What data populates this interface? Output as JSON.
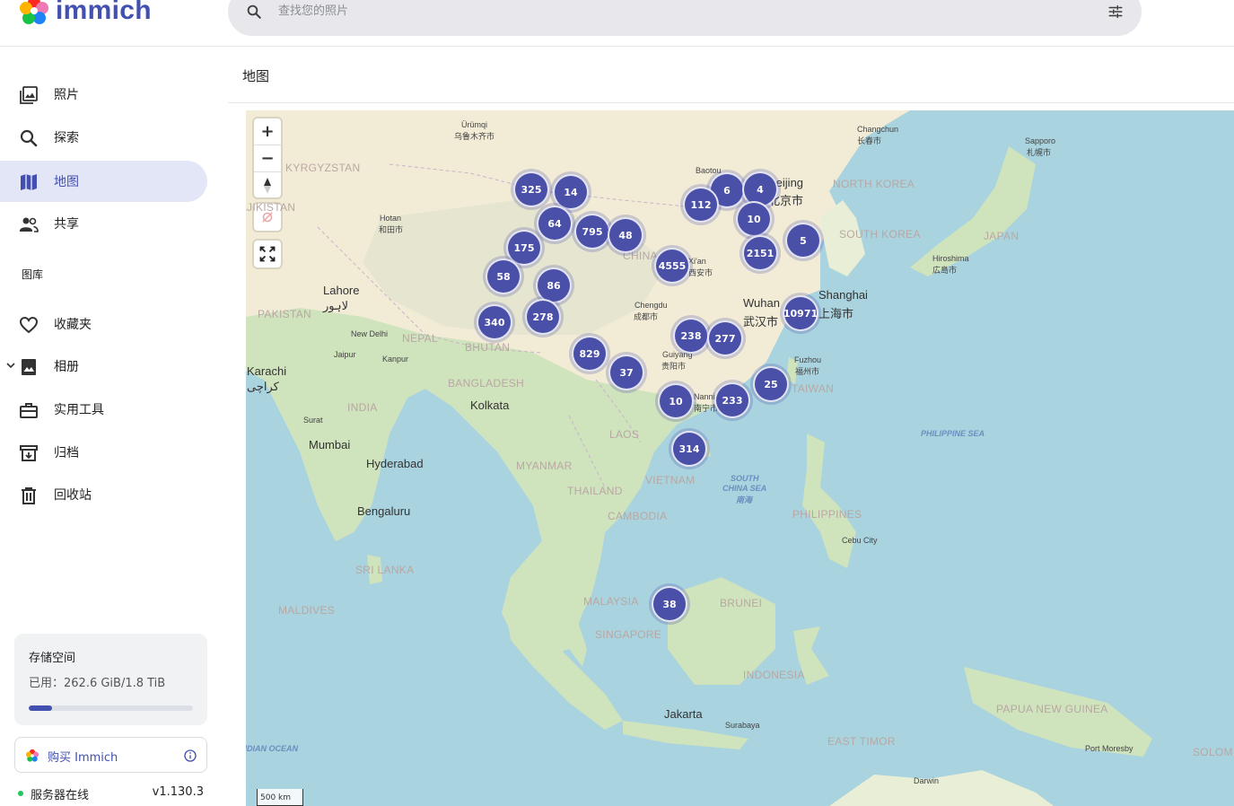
{
  "app": {
    "name": "immich",
    "search_placeholder": "查找您的照片"
  },
  "sidebar": {
    "items": [
      {
        "label": "照片",
        "icon": "photos-icon",
        "active": false
      },
      {
        "label": "探索",
        "icon": "search-icon",
        "active": false
      },
      {
        "label": "地图",
        "icon": "map-icon",
        "active": true
      },
      {
        "label": "共享",
        "icon": "people-icon",
        "active": false
      }
    ],
    "library_title": "图库",
    "library_items": [
      {
        "label": "收藏夹",
        "icon": "heart-icon"
      },
      {
        "label": "相册",
        "icon": "album-icon"
      },
      {
        "label": "实用工具",
        "icon": "toolbox-icon"
      },
      {
        "label": "归档",
        "icon": "archive-icon"
      },
      {
        "label": "回收站",
        "icon": "trash-icon"
      }
    ],
    "storage": {
      "title": "存储空间",
      "used_text": "已用：262.6 GiB/1.8 TiB",
      "used_fraction": 0.14
    },
    "buy_label": "购买 Immich",
    "server": {
      "status": "服务器在线",
      "version": "v1.130.3",
      "status_color": "#22c55e"
    }
  },
  "main": {
    "title": "地图"
  },
  "map": {
    "scale_label": "500 km",
    "clusters": [
      "325",
      "14",
      "64",
      "795",
      "48",
      "175",
      "58",
      "86",
      "340",
      "278",
      "829",
      "37",
      "6",
      "4",
      "112",
      "10",
      "2151",
      "5",
      "4555",
      "10971",
      "238",
      "277",
      "25",
      "10",
      "233",
      "314",
      "38"
    ],
    "countries": [
      "KYRGYZSTAN",
      "TAJIKISTAN",
      "PAKISTAN",
      "NEPAL",
      "BHUTAN",
      "BANGLADESH",
      "INDIA",
      "CHINA",
      "NORTH KOREA",
      "SOUTH KOREA",
      "JAPAN",
      "MYANMAR",
      "LAOS",
      "THAILAND",
      "VIETNAM",
      "CAMBODIA",
      "TAIWAN",
      "PHILIPPINES",
      "SRI LANKA",
      "MALDIVES",
      "MALAYSIA",
      "BRUNEI",
      "SINGAPORE",
      "INDONESIA",
      "PAPUA NEW GUINEA",
      "EAST TIMOR",
      "SOLOM"
    ],
    "cities": [
      "Ürümqi",
      "乌鲁木齐市",
      "Baotou",
      "Beijing",
      "北京市",
      "Changchun",
      "长春市",
      "Sapporo",
      "札幌市",
      "Hotan",
      "和田市",
      "Lahore",
      "لاہور",
      "New Delhi",
      "Jaipur",
      "Kanpur",
      "Karachi",
      "کراچی",
      "Kolkata",
      "Surat",
      "Mumbai",
      "Hyderabad",
      "Bengaluru",
      "Chengdu",
      "成都市",
      "Wuhan",
      "武汉市",
      "Shanghai",
      "上海市",
      "Guiyang",
      "贵阳市",
      "Fuzhou",
      "福州市",
      "Hiroshima",
      "広島市",
      "Xi'an",
      "西安市",
      "Cebu City",
      "Jakarta",
      "Surabaya",
      "Port Moresby",
      "Darwin",
      "Nanning",
      "南宁市"
    ],
    "seas": [
      "PHILIPPINE SEA",
      "SOUTH",
      "CHINA SEA",
      "南海",
      "INDIAN OCEAN"
    ]
  }
}
